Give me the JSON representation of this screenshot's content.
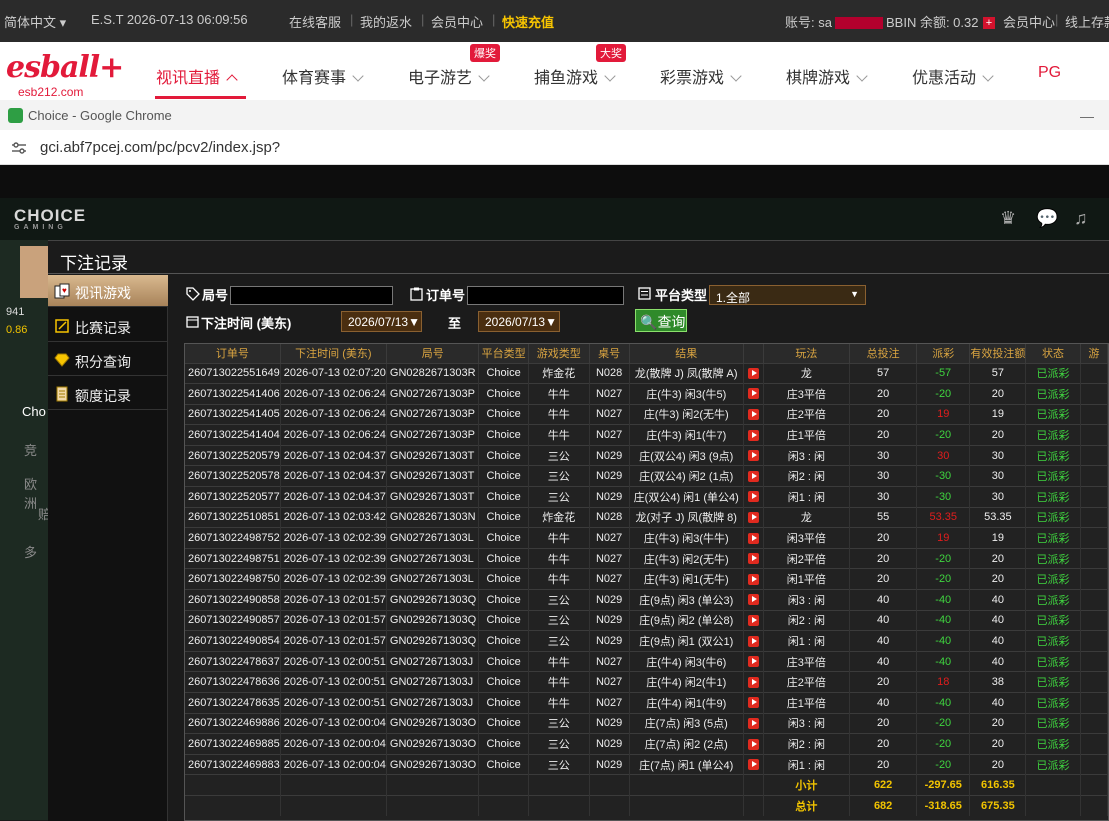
{
  "topbar": {
    "language": "简体中文",
    "clock": "E.S.T 2026-07-13 06:09:56",
    "links": [
      "在线客服",
      "我的返水",
      "会员中心"
    ],
    "recharge": "快速充值",
    "account_label": "账号: sa",
    "balance_label": "BBIN 余额: 0.32",
    "member_center": "会员中心",
    "online_deposit": "线上存款"
  },
  "site": {
    "logo_text": "esball+",
    "logo_sub": "esb212.com",
    "nav": [
      {
        "label": "视讯直播",
        "badge": ""
      },
      {
        "label": "体育赛事",
        "badge": ""
      },
      {
        "label": "电子游艺",
        "badge": "爆奖"
      },
      {
        "label": "捕鱼游戏",
        "badge": "大奖"
      },
      {
        "label": "彩票游戏",
        "badge": ""
      },
      {
        "label": "棋牌游戏",
        "badge": ""
      },
      {
        "label": "优惠活动",
        "badge": ""
      },
      {
        "label": "PG",
        "badge": ""
      }
    ]
  },
  "chrome": {
    "title": "Choice - Google Chrome",
    "url": "gci.abf7pcej.com/pc/pcv2/index.jsp?"
  },
  "game": {
    "brand": "CHOICE",
    "brand_sub": "GAMING",
    "left_labels": [
      "941",
      "0.86",
      "Cho",
      "竞",
      "欧洲",
      "赔",
      "多"
    ]
  },
  "modal": {
    "title": "下注记录",
    "menu": [
      "视讯游戏",
      "比赛记录",
      "积分查询",
      "额度记录"
    ],
    "filters": {
      "round_label": "局号",
      "order_label": "订单号",
      "platform_label": "平台类型",
      "platform_value": "1.全部",
      "time_label": "下注时间 (美东)",
      "date_from": "2026/07/13",
      "to_label": "至",
      "date_to": "2026/07/13",
      "query_label": "查询"
    },
    "columns": [
      "订单号",
      "下注时间 (美东)",
      "局号",
      "平台类型",
      "游戏类型",
      "桌号",
      "结果",
      "",
      "玩法",
      "总投注",
      "派彩",
      "有效投注额",
      "状态",
      "游"
    ],
    "rows": [
      [
        "260713022551649",
        "2026-07-13 02:07:20",
        "GN0282671303R",
        "Choice",
        "炸金花",
        "N028",
        "龙(散牌 J) 凤(散牌 A)",
        "龙",
        "57",
        "-57",
        "57",
        "已派彩"
      ],
      [
        "260713022541406",
        "2026-07-13 02:06:24",
        "GN0272671303P",
        "Choice",
        "牛牛",
        "N027",
        "庄(牛3) 闲3(牛5)",
        "庄3平倍",
        "20",
        "-20",
        "20",
        "已派彩"
      ],
      [
        "260713022541405",
        "2026-07-13 02:06:24",
        "GN0272671303P",
        "Choice",
        "牛牛",
        "N027",
        "庄(牛3) 闲2(无牛)",
        "庄2平倍",
        "20",
        "19",
        "19",
        "已派彩"
      ],
      [
        "260713022541404",
        "2026-07-13 02:06:24",
        "GN0272671303P",
        "Choice",
        "牛牛",
        "N027",
        "庄(牛3) 闲1(牛7)",
        "庄1平倍",
        "20",
        "-20",
        "20",
        "已派彩"
      ],
      [
        "260713022520579",
        "2026-07-13 02:04:37",
        "GN0292671303T",
        "Choice",
        "三公",
        "N029",
        "庄(双公4) 闲3 (9点)",
        "闲3 : 闲",
        "30",
        "30",
        "30",
        "已派彩"
      ],
      [
        "260713022520578",
        "2026-07-13 02:04:37",
        "GN0292671303T",
        "Choice",
        "三公",
        "N029",
        "庄(双公4) 闲2 (1点)",
        "闲2 : 闲",
        "30",
        "-30",
        "30",
        "已派彩"
      ],
      [
        "260713022520577",
        "2026-07-13 02:04:37",
        "GN0292671303T",
        "Choice",
        "三公",
        "N029",
        "庄(双公4) 闲1 (单公4)",
        "闲1 : 闲",
        "30",
        "-30",
        "30",
        "已派彩"
      ],
      [
        "260713022510851",
        "2026-07-13 02:03:42",
        "GN0282671303N",
        "Choice",
        "炸金花",
        "N028",
        "龙(对子 J) 凤(散牌 8)",
        "龙",
        "55",
        "53.35",
        "53.35",
        "已派彩"
      ],
      [
        "260713022498752",
        "2026-07-13 02:02:39",
        "GN0272671303L",
        "Choice",
        "牛牛",
        "N027",
        "庄(牛3) 闲3(牛牛)",
        "闲3平倍",
        "20",
        "19",
        "19",
        "已派彩"
      ],
      [
        "260713022498751",
        "2026-07-13 02:02:39",
        "GN0272671303L",
        "Choice",
        "牛牛",
        "N027",
        "庄(牛3) 闲2(无牛)",
        "闲2平倍",
        "20",
        "-20",
        "20",
        "已派彩"
      ],
      [
        "260713022498750",
        "2026-07-13 02:02:39",
        "GN0272671303L",
        "Choice",
        "牛牛",
        "N027",
        "庄(牛3) 闲1(无牛)",
        "闲1平倍",
        "20",
        "-20",
        "20",
        "已派彩"
      ],
      [
        "260713022490858",
        "2026-07-13 02:01:57",
        "GN0292671303Q",
        "Choice",
        "三公",
        "N029",
        "庄(9点) 闲3 (单公3)",
        "闲3 : 闲",
        "40",
        "-40",
        "40",
        "已派彩"
      ],
      [
        "260713022490857",
        "2026-07-13 02:01:57",
        "GN0292671303Q",
        "Choice",
        "三公",
        "N029",
        "庄(9点) 闲2 (单公8)",
        "闲2 : 闲",
        "40",
        "-40",
        "40",
        "已派彩"
      ],
      [
        "260713022490854",
        "2026-07-13 02:01:57",
        "GN0292671303Q",
        "Choice",
        "三公",
        "N029",
        "庄(9点) 闲1 (双公1)",
        "闲1 : 闲",
        "40",
        "-40",
        "40",
        "已派彩"
      ],
      [
        "260713022478637",
        "2026-07-13 02:00:51",
        "GN0272671303J",
        "Choice",
        "牛牛",
        "N027",
        "庄(牛4) 闲3(牛6)",
        "庄3平倍",
        "40",
        "-40",
        "40",
        "已派彩"
      ],
      [
        "260713022478636",
        "2026-07-13 02:00:51",
        "GN0272671303J",
        "Choice",
        "牛牛",
        "N027",
        "庄(牛4) 闲2(牛1)",
        "庄2平倍",
        "20",
        "18",
        "38",
        "已派彩"
      ],
      [
        "260713022478635",
        "2026-07-13 02:00:51",
        "GN0272671303J",
        "Choice",
        "牛牛",
        "N027",
        "庄(牛4) 闲1(牛9)",
        "庄1平倍",
        "40",
        "-40",
        "40",
        "已派彩"
      ],
      [
        "260713022469886",
        "2026-07-13 02:00:04",
        "GN0292671303O",
        "Choice",
        "三公",
        "N029",
        "庄(7点) 闲3 (5点)",
        "闲3 : 闲",
        "20",
        "-20",
        "20",
        "已派彩"
      ],
      [
        "260713022469885",
        "2026-07-13 02:00:04",
        "GN0292671303O",
        "Choice",
        "三公",
        "N029",
        "庄(7点) 闲2 (2点)",
        "闲2 : 闲",
        "20",
        "-20",
        "20",
        "已派彩"
      ],
      [
        "260713022469883",
        "2026-07-13 02:00:04",
        "GN0292671303O",
        "Choice",
        "三公",
        "N029",
        "庄(7点) 闲1 (单公4)",
        "闲1 : 闲",
        "20",
        "-20",
        "20",
        "已派彩"
      ]
    ],
    "subtotal": {
      "label": "小计",
      "bet": "622",
      "payout": "-297.65",
      "valid": "616.35"
    },
    "total": {
      "label": "总计",
      "bet": "682",
      "payout": "-318.65",
      "valid": "675.35"
    },
    "colors": {
      "positive": "#3fd43f",
      "negative": "#e11d1d",
      "header": "#d9a441",
      "sum": "#f2c400"
    }
  }
}
